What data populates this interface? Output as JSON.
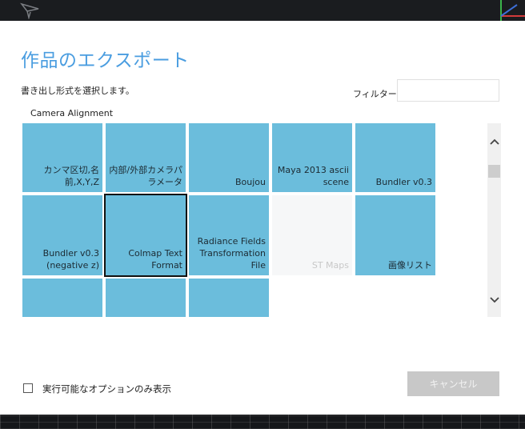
{
  "dialog": {
    "title": "作品のエクスポート",
    "subtitle": "書き出し形式を選択します。",
    "filter_label": "フィルター",
    "filter_value": "",
    "category": "Camera Alignment",
    "formats": [
      {
        "label": "カンマ区切,名前,X,Y,Z",
        "state": "normal"
      },
      {
        "label": "内部/外部カメラパラメータ",
        "state": "normal"
      },
      {
        "label": "Boujou",
        "state": "normal"
      },
      {
        "label": "Maya 2013 ascii scene",
        "state": "normal"
      },
      {
        "label": "Bundler v0.3",
        "state": "normal"
      },
      {
        "label": "Bundler v0.3 (negative z)",
        "state": "normal"
      },
      {
        "label": "Colmap Text Format",
        "state": "selected"
      },
      {
        "label": "Radiance Fields Transformation File",
        "state": "normal"
      },
      {
        "label": "ST Maps",
        "state": "disabled"
      },
      {
        "label": "画像リスト",
        "state": "normal"
      },
      {
        "label": "",
        "state": "normal"
      },
      {
        "label": "",
        "state": "normal"
      },
      {
        "label": "",
        "state": "normal"
      }
    ],
    "checkbox": {
      "label": "実行可能なオプションのみ表示",
      "checked": false
    },
    "cancel_label": "キャンセル"
  },
  "colors": {
    "accent": "#4a9de0",
    "tile": "#6bbddc",
    "tile_disabled": "#f6f7f8",
    "button_disabled": "#c8c8c8"
  },
  "icons": {
    "app_logo": "paper-plane-logo",
    "scroll_up": "chevron-up-icon",
    "scroll_down": "chevron-down-icon",
    "viewport_gizmo": "axis-gizmo-icon"
  }
}
